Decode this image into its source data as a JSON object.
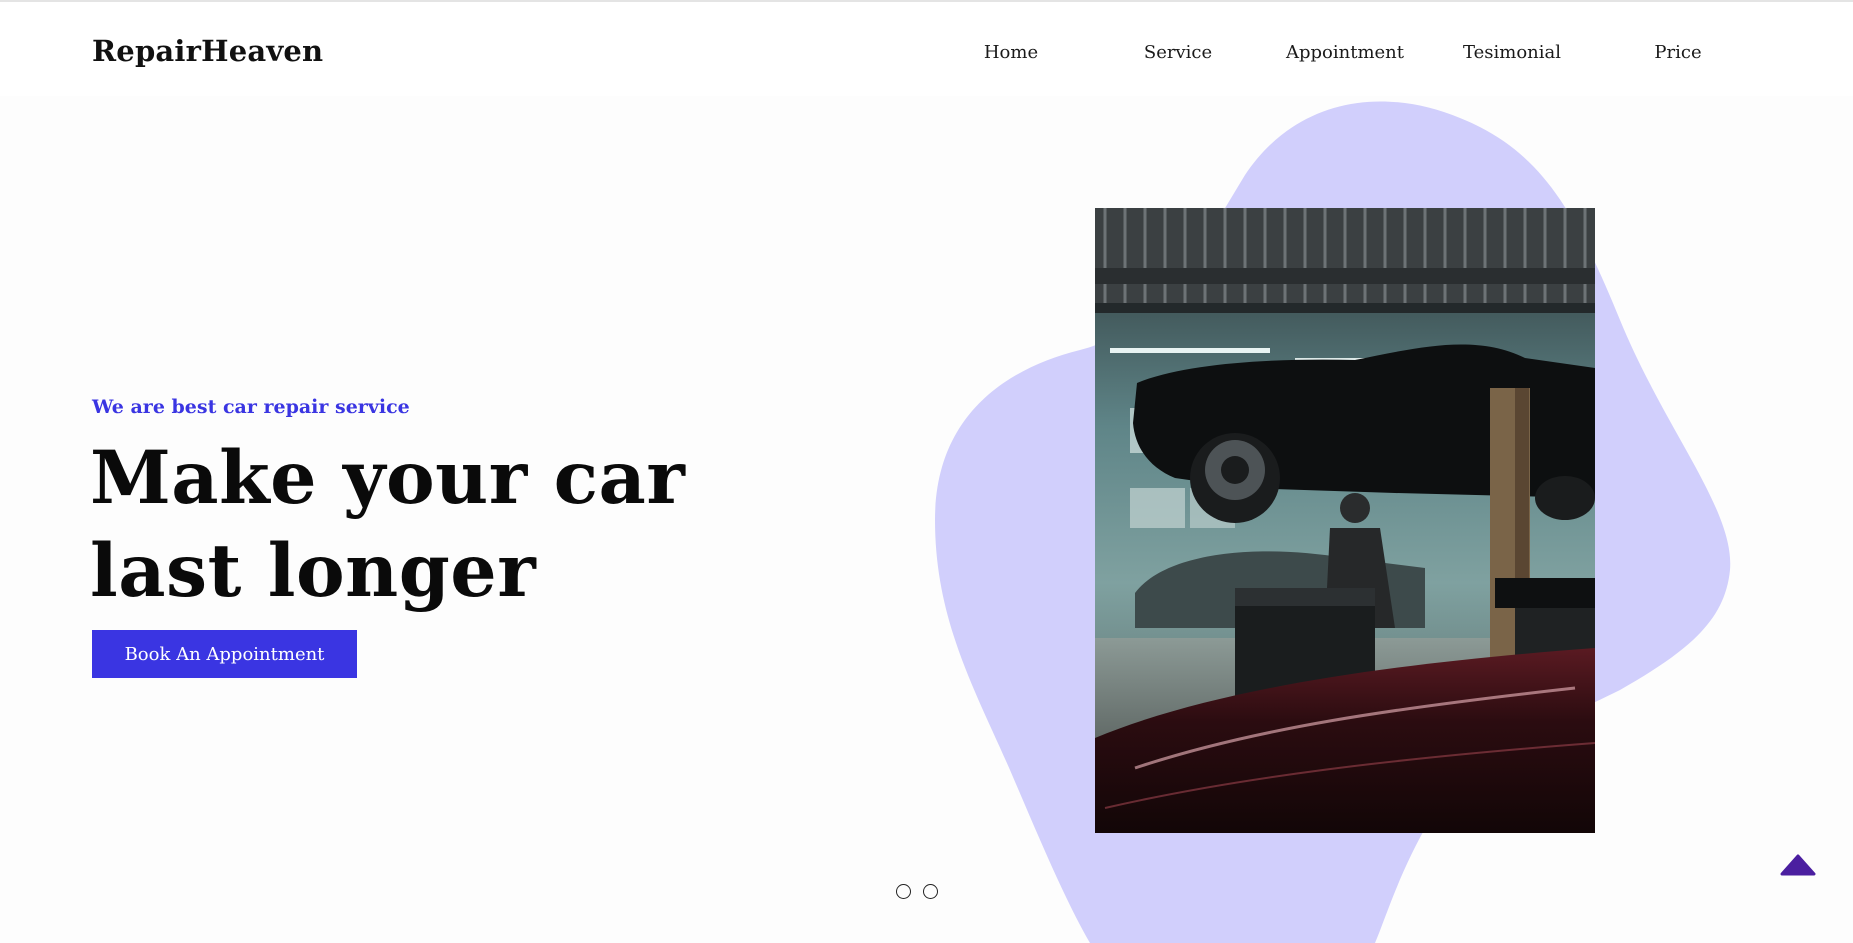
{
  "brand": {
    "name": "RepairHeaven"
  },
  "nav": {
    "items": [
      {
        "label": "Home"
      },
      {
        "label": "Service"
      },
      {
        "label": "Appointment"
      },
      {
        "label": "Tesimonial"
      },
      {
        "label": "Price"
      }
    ]
  },
  "hero": {
    "eyebrow": "We are best car repair service",
    "headline": "Make your car last longer",
    "cta_label": "Book An Appointment",
    "image_alt": "mechanic working under a lifted car in a garage"
  },
  "carousel": {
    "slide_count": 2,
    "active_index": 0
  },
  "colors": {
    "accent": "#3a35e2",
    "blob": "#d1cffc",
    "scroll_top": "#4b1fa0"
  },
  "icons": {
    "scroll_top": "caret-up-icon"
  }
}
